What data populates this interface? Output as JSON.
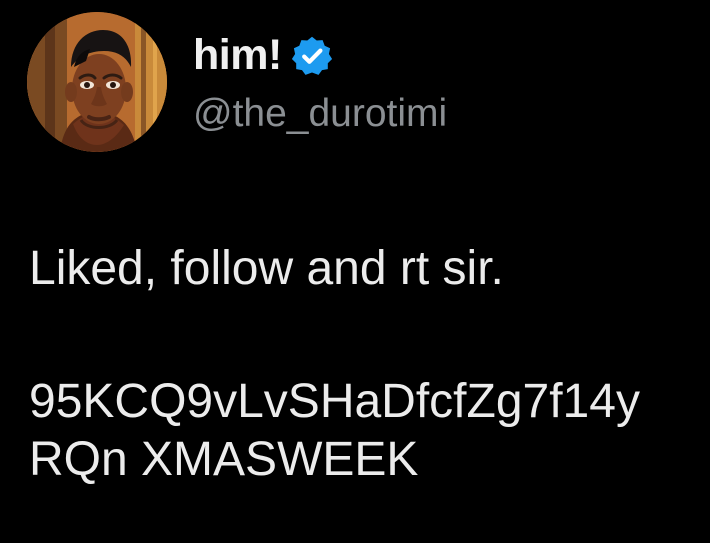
{
  "tweet": {
    "display_name": "him!",
    "handle": "@the_durotimi",
    "lines": [
      "Liked, follow and rt sir.",
      "95KCQ9vLvSHaDfcfZg7f14y",
      "RQn XMASWEEK"
    ]
  },
  "icons": {
    "verified": "verified-badge-icon",
    "avatar": "profile-avatar"
  },
  "colors": {
    "background": "#000000",
    "text": "#e7e9ea",
    "handle": "#8b8f93",
    "verified_blue": "#1d9bf0"
  }
}
